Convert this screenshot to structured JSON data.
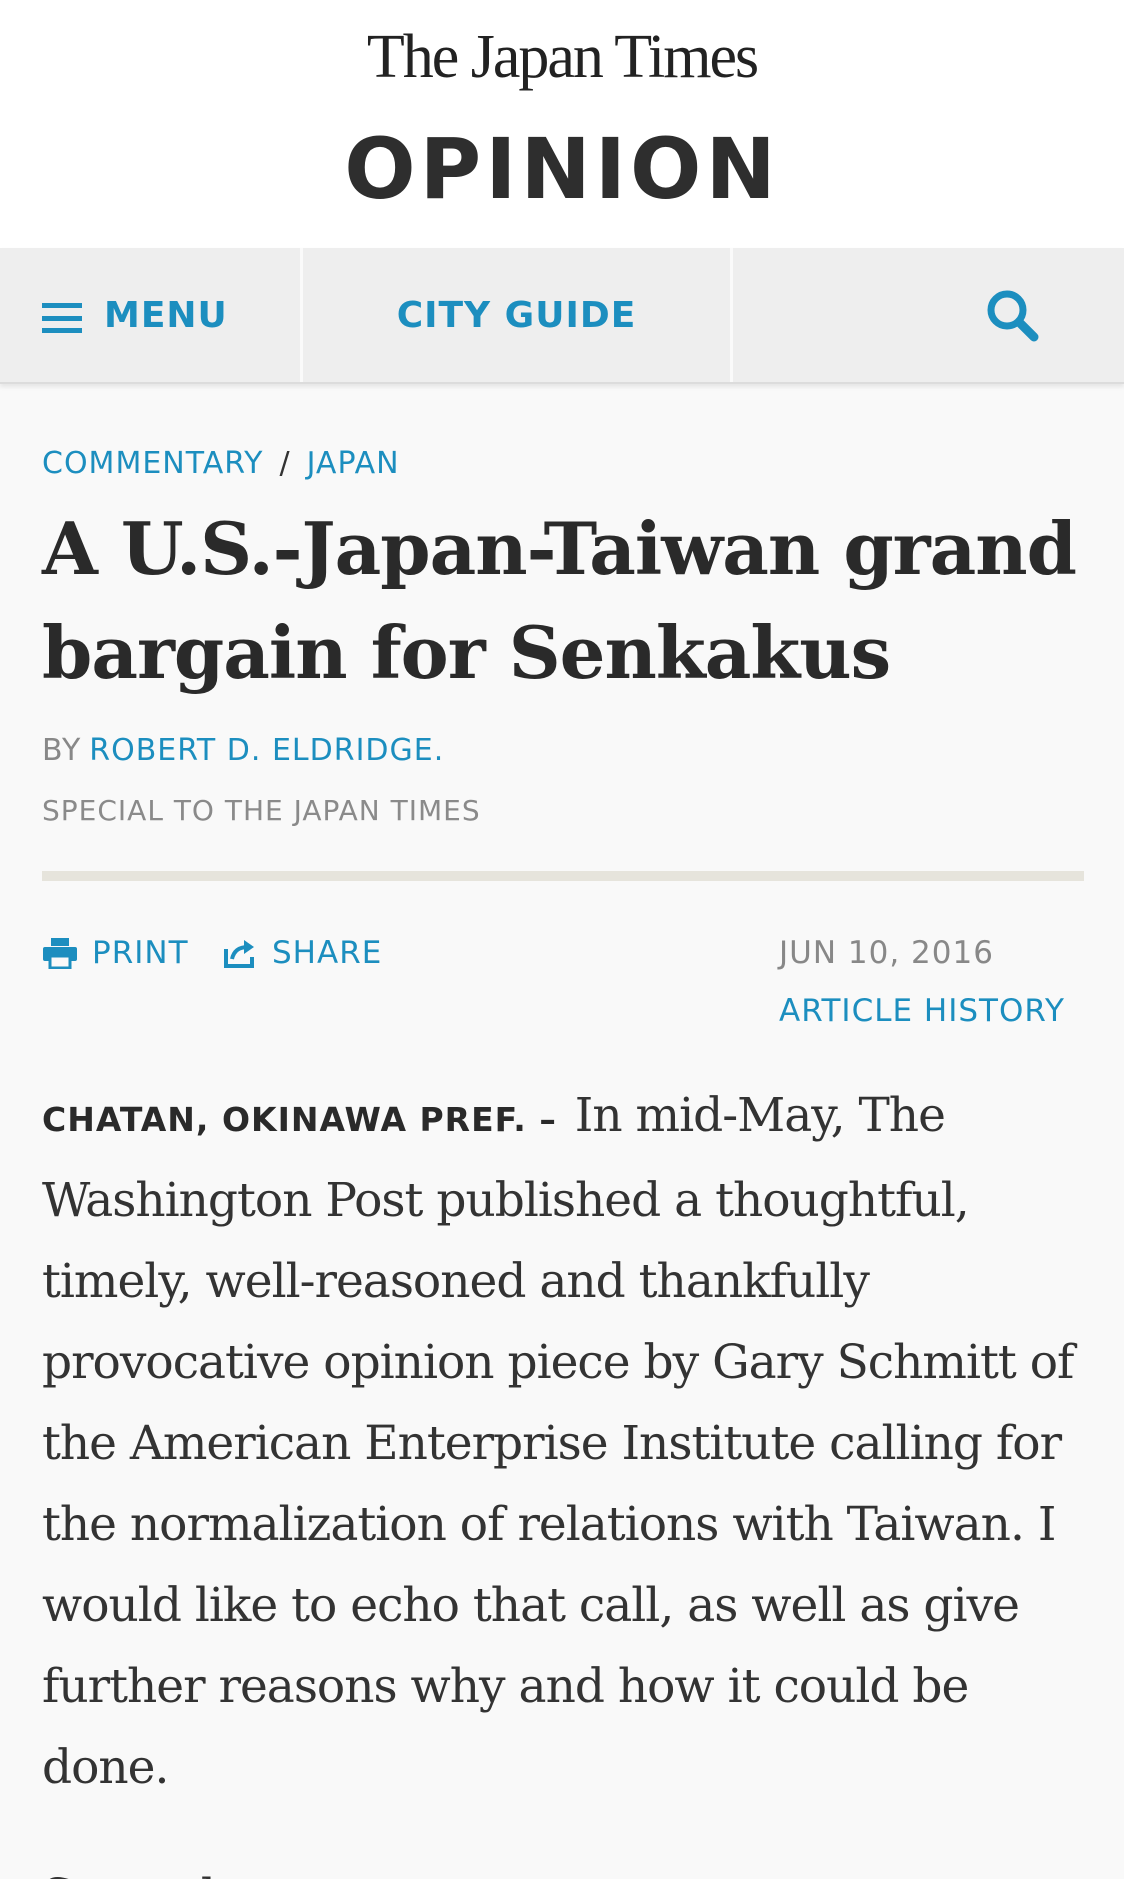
{
  "header": {
    "logo_text": "The Japan Times",
    "section_title": "OPINION"
  },
  "nav": {
    "menu_label": "MENU",
    "city_guide_label": "CITY GUIDE",
    "search_icon": "search-icon",
    "accent_color": "#1c8ebf"
  },
  "article": {
    "breadcrumb": [
      "COMMENTARY",
      "JAPAN"
    ],
    "breadcrumb_separator": "/",
    "headline": "A U.S.-Japan-Taiwan grand bargain for Senkakus",
    "byline_prefix": "BY",
    "author": "ROBERT D. ELDRIDGE.",
    "credit": "SPECIAL TO THE JAPAN TIMES",
    "print_label": "PRINT",
    "share_label": "SHARE",
    "date": "JUN 10, 2016",
    "history_label": "ARTICLE HISTORY",
    "dateline": "CHATAN, OKINAWA PREF. –",
    "lead_paragraph": "In mid-May, The Washington Post published a thoughtful, timely, well-reasoned and thankfully provocative opinion piece by Gary Schmitt of the American Enterprise Institute calling for the normalization of relations with Taiwan. I would like to echo that call, as well as give further reasons why and how it could be done.",
    "next_paragraph_partial": "Several..."
  }
}
